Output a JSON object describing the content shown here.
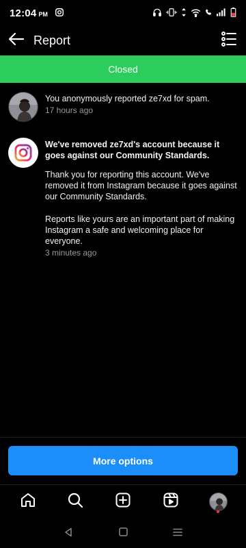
{
  "status_bar": {
    "time": "12:04",
    "ampm": "PM"
  },
  "header": {
    "title": "Report",
    "back_icon": "arrow-left-icon",
    "menu_icon": "list-menu-icon"
  },
  "banner": {
    "label": "Closed",
    "color": "#2ccd5c"
  },
  "reports": [
    {
      "text": "You anonymously reported ze7xd for spam.",
      "time": "17 hours ago"
    },
    {
      "heading": "We've removed ze7xd's account because it goes against our Community Standards.",
      "para1": "Thank you for reporting this account. We've removed it from Instagram because it goes against our Community Standards.",
      "para2": "Reports like yours are an important part of making Instagram a safe and welcoming place for everyone.",
      "time": "3 minutes ago"
    }
  ],
  "actions": {
    "more_options": "More options",
    "color": "#1c8ef9"
  },
  "bottom_nav": [
    "home-icon",
    "search-icon",
    "create-icon",
    "reels-icon",
    "profile-avatar"
  ],
  "system_nav": [
    "back-triangle-icon",
    "home-square-icon",
    "recents-icon"
  ]
}
